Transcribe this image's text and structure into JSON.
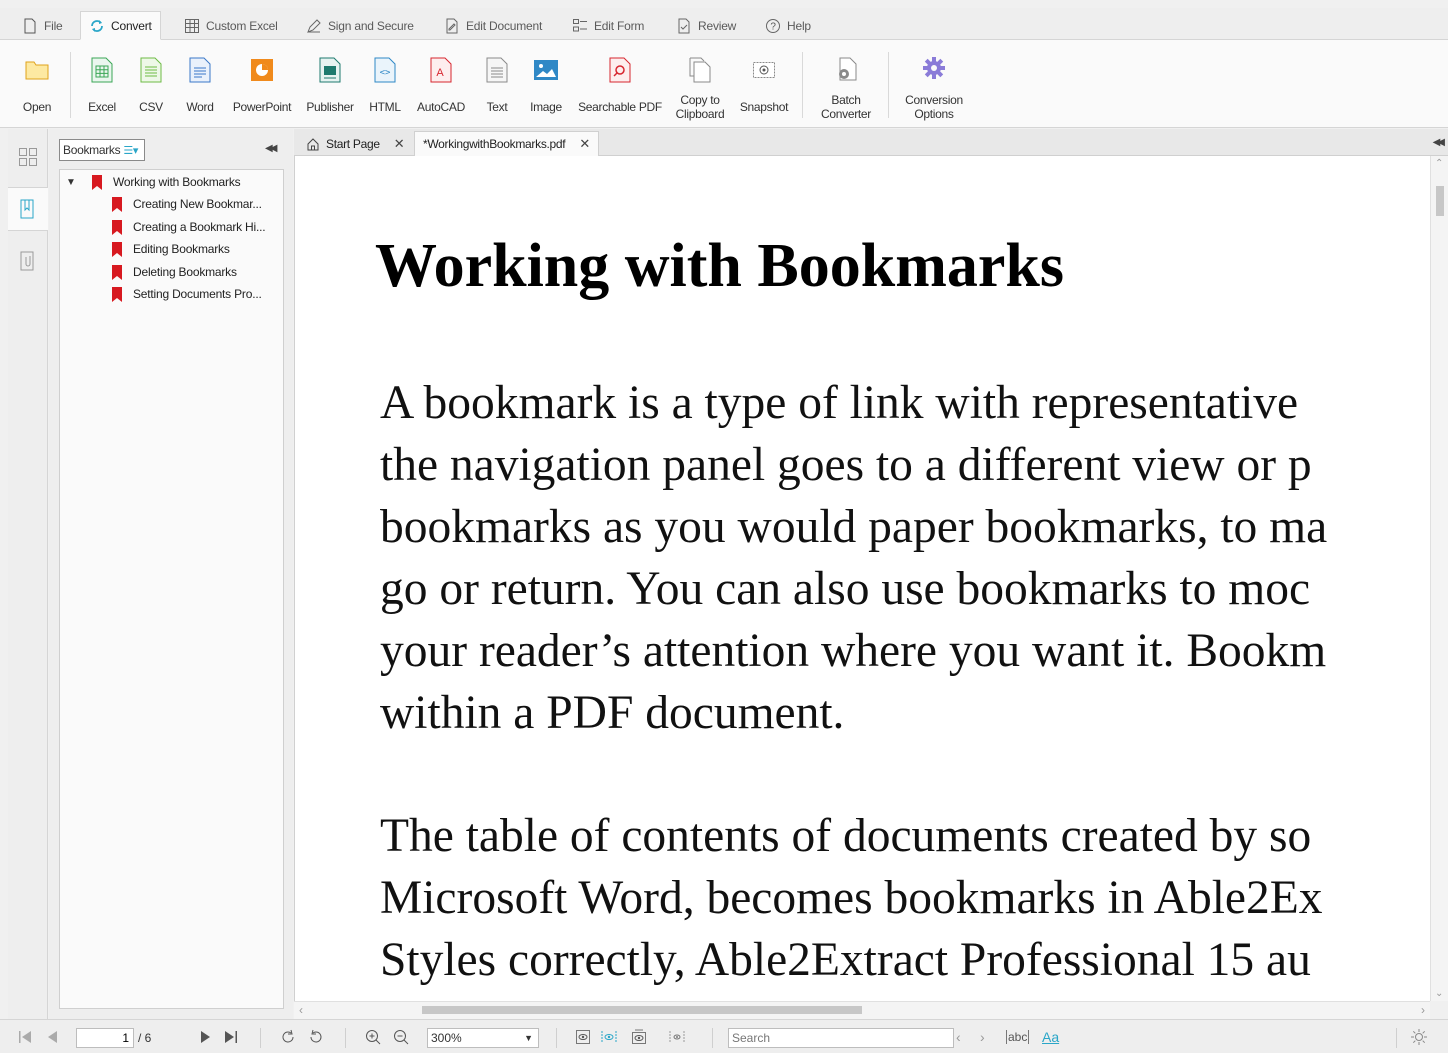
{
  "ribbon_tabs": [
    {
      "label": "File",
      "icon": "file-icon"
    },
    {
      "label": "Convert",
      "icon": "convert-icon",
      "active": true
    },
    {
      "label": "Custom Excel",
      "icon": "grid-icon"
    },
    {
      "label": "Sign and Secure",
      "icon": "pen-icon"
    },
    {
      "label": "Edit Document",
      "icon": "edit-icon"
    },
    {
      "label": "Edit Form",
      "icon": "form-icon"
    },
    {
      "label": "Review",
      "icon": "checkbox-icon"
    },
    {
      "label": "Help",
      "icon": "help-icon"
    }
  ],
  "toolbar": {
    "open": "Open",
    "excel": "Excel",
    "csv": "CSV",
    "word": "Word",
    "powerpoint": "PowerPoint",
    "publisher": "Publisher",
    "html": "HTML",
    "autocad": "AutoCAD",
    "text": "Text",
    "image": "Image",
    "searchable_pdf": "Searchable PDF",
    "copy_clipboard_1": "Copy to",
    "copy_clipboard_2": "Clipboard",
    "snapshot": "Snapshot",
    "batch_1": "Batch",
    "batch_2": "Converter",
    "options_1": "Conversion",
    "options_2": "Options"
  },
  "bookmarks_panel": {
    "dropdown_label": "Bookmarks",
    "root": "Working with Bookmarks",
    "children": [
      "Creating New Bookmar...",
      "Creating a Bookmark Hi...",
      "Editing Bookmarks",
      "Deleting Bookmarks",
      "Setting Documents Pro..."
    ]
  },
  "doc_tabs": [
    {
      "label": "Start Page"
    },
    {
      "label": "*WorkingwithBookmarks.pdf",
      "active": true
    }
  ],
  "document": {
    "title": "Working with Bookmarks",
    "para1": [
      "A bookmark is a type of link with representative",
      "the navigation panel goes to a different view or p",
      "bookmarks as you would paper bookmarks, to ma",
      "go or return. You can also use bookmarks to moc",
      "your reader’s attention where you want it. Bookm",
      "within a PDF document."
    ],
    "para2": [
      "The table of contents of documents created by so",
      "Microsoft Word, becomes bookmarks in Able2Ex",
      "Styles correctly, Able2Extract Professional 15 au"
    ]
  },
  "statusbar": {
    "page_current": "1",
    "page_total": "/ 6",
    "zoom": "300%",
    "search_placeholder": "Search",
    "match_case": "abc",
    "font_case": "Aa"
  },
  "colors": {
    "accent": "#2aa6c8",
    "bookmark_red": "#d71920",
    "excel_green": "#3aa655",
    "word_blue": "#3b78c8",
    "powerpoint_orange": "#f08a1c",
    "publisher_teal": "#1d7a6e",
    "autocad_red": "#d7262f",
    "options_purple": "#8a7bd8"
  }
}
